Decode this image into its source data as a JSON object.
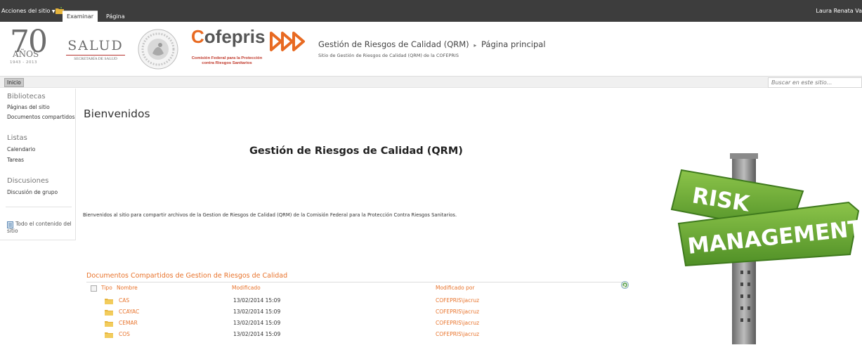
{
  "ribbon": {
    "site_actions": "Acciones del sitio",
    "tabs": [
      "Examinar",
      "Página"
    ],
    "user": "Laura Renata Va"
  },
  "header": {
    "logo_70": {
      "number": "70",
      "anos": "AÑOS",
      "years": "1943 - 2013"
    },
    "salud": {
      "title": "SALUD",
      "subtitle": "SECRETARÍA DE SALUD"
    },
    "cofepris": {
      "name_first": "C",
      "name_rest": "ofepris",
      "sub1": "Comisión Federal para la Protección",
      "sub2": "contra Riesgos Sanitarios"
    },
    "breadcrumb": {
      "site": "Gestión de Riesgos de Calidad (QRM)",
      "separator": "▸",
      "page": "Página principal"
    },
    "site_description": "Sitio de Gestión de Riesgos de Calidad  (QRM) de la COFEPRIS"
  },
  "topnav": {
    "home": "Inicio",
    "search_placeholder": "Buscar en este sitio..."
  },
  "leftnav": {
    "sections": [
      {
        "heading": "Bibliotecas",
        "items": [
          "Páginas del sitio",
          "Documentos compartidos"
        ]
      },
      {
        "heading": "Listas",
        "items": [
          "Calendario",
          "Tareas"
        ]
      },
      {
        "heading": "Discusiones",
        "items": [
          "Discusión de grupo"
        ]
      }
    ],
    "all_content": "Todo el contenido del sitio"
  },
  "main": {
    "welcome": "Bienvenidos",
    "heading": "Gestión de Riesgos de Calidad (QRM)",
    "intro": "Bienvenidos al sitio para compartir archivos de la Gestion de Riesgos de Calidad (QRM) de la Comisión Federal para la Protección Contra Riesgos Sanitarios."
  },
  "library": {
    "title": "Documentos Compartidos de Gestion de Riesgos de Calidad",
    "columns": {
      "type": "Tipo",
      "name": "Nombre",
      "modified": "Modificado",
      "modified_by": "Modificado por"
    },
    "rows": [
      {
        "name": "CAS",
        "modified": "13/02/2014 15:09",
        "modified_by": "COFEPRIS\\jacruz"
      },
      {
        "name": "CCAYAC",
        "modified": "13/02/2014 15:09",
        "modified_by": "COFEPRIS\\jacruz"
      },
      {
        "name": "CEMAR",
        "modified": "13/02/2014 15:09",
        "modified_by": "COFEPRIS\\jacruz"
      },
      {
        "name": "COS",
        "modified": "13/02/2014 15:09",
        "modified_by": "COFEPRIS\\jacruz"
      }
    ]
  },
  "sign": {
    "word1": "RISK",
    "word2": "MANAGEMENT"
  },
  "colors": {
    "ribbon": "#3d3d3d",
    "accent_orange": "#e8732b",
    "sign_green": "#62a52f"
  },
  "icons": [
    "caret-down-icon",
    "navigate-up-icon",
    "folder-icon",
    "refresh-icon",
    "all-content-icon"
  ]
}
